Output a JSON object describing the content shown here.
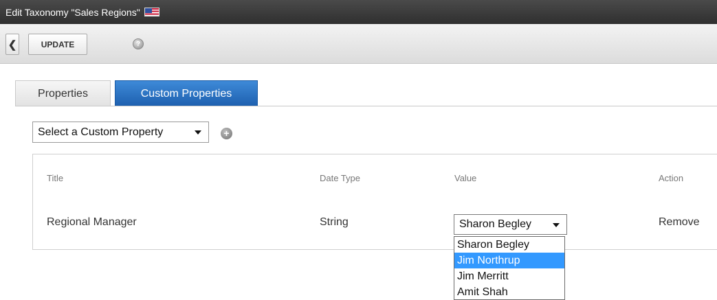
{
  "window": {
    "title": "Edit Taxonomy \"Sales Regions\""
  },
  "toolbar": {
    "back_label": "❮",
    "update_label": "UPDATE",
    "help_label": "?"
  },
  "tabs": [
    {
      "label": "Properties",
      "active": false
    },
    {
      "label": "Custom Properties",
      "active": true
    }
  ],
  "custom_property_select": {
    "value": "Select a Custom Property"
  },
  "add_label": "+",
  "table": {
    "headers": [
      "Title",
      "Date Type",
      "Value",
      "Action"
    ],
    "rows": [
      {
        "title": "Regional Manager",
        "type": "String",
        "value": "Sharon Begley",
        "action": "Remove"
      }
    ]
  },
  "value_dropdown": {
    "options": [
      "Sharon Begley",
      "Jim Northrup",
      "Jim Merritt",
      "Amit Shah"
    ],
    "highlighted_index": 1
  },
  "colors": {
    "titlebar": "#3a3a3a",
    "active_tab": "#2b72c4",
    "highlight": "#3399ff"
  },
  "icons": [
    "flag-us-icon",
    "back-icon",
    "help-icon",
    "add-icon",
    "dropdown-arrow-icon"
  ]
}
